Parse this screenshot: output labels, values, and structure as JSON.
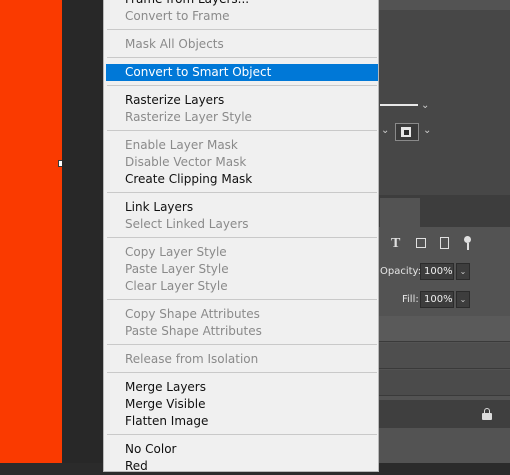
{
  "colors": {
    "canvas_fill": "#fa3a00",
    "menu_background": "#f0f0f0",
    "menu_highlight": "#0078d7",
    "panel_background": "#535353"
  },
  "context_menu": {
    "items": [
      {
        "label": "Frame from Layers...",
        "state": "enabled"
      },
      {
        "label": "Convert to Frame",
        "state": "disabled"
      },
      {
        "label": "Mask All Objects",
        "state": "disabled"
      },
      {
        "label": "Convert to Smart Object",
        "state": "selected"
      },
      {
        "label": "Rasterize Layers",
        "state": "enabled"
      },
      {
        "label": "Rasterize Layer Style",
        "state": "disabled"
      },
      {
        "label": "Enable Layer Mask",
        "state": "disabled"
      },
      {
        "label": "Disable Vector Mask",
        "state": "disabled"
      },
      {
        "label": "Create Clipping Mask",
        "state": "enabled"
      },
      {
        "label": "Link Layers",
        "state": "enabled"
      },
      {
        "label": "Select Linked Layers",
        "state": "disabled"
      },
      {
        "label": "Copy Layer Style",
        "state": "disabled"
      },
      {
        "label": "Paste Layer Style",
        "state": "disabled"
      },
      {
        "label": "Clear Layer Style",
        "state": "disabled"
      },
      {
        "label": "Copy Shape Attributes",
        "state": "disabled"
      },
      {
        "label": "Paste Shape Attributes",
        "state": "disabled"
      },
      {
        "label": "Release from Isolation",
        "state": "disabled"
      },
      {
        "label": "Merge Layers",
        "state": "enabled"
      },
      {
        "label": "Merge Visible",
        "state": "enabled"
      },
      {
        "label": "Flatten Image",
        "state": "enabled"
      },
      {
        "label": "No Color",
        "state": "enabled"
      },
      {
        "label": "Red",
        "state": "enabled"
      }
    ]
  },
  "layers_panel": {
    "opacity_label": "Opacity:",
    "opacity_value": "100%",
    "fill_label": "Fill:",
    "fill_value": "100%",
    "type_filter_icon": "T",
    "dropdown_chevron": "⌄"
  }
}
